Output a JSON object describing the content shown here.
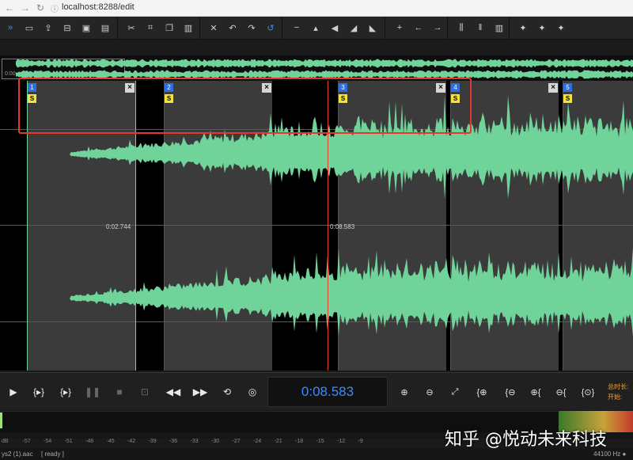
{
  "browser": {
    "back": "←",
    "forward": "→",
    "reload": "↻",
    "info": "ⓘ",
    "url": "localhost:8288/edit"
  },
  "toolbar": {
    "icons": [
      "expand-icon",
      "open-folder-icon",
      "upload-icon",
      "export-icon",
      "save-icon",
      "save-as-icon",
      "cut-icon",
      "crop-icon",
      "copy-icon",
      "paste-icon",
      "delete-icon",
      "undo-icon",
      "redo-icon",
      "reset-icon",
      "minus-icon",
      "plus-small-icon",
      "volume-icon",
      "fade-in-icon",
      "fade-out-icon",
      "add-icon",
      "arrow-left-icon",
      "arrow-right-icon",
      "equalizer-icon",
      "barcode-icon",
      "library-icon",
      "bird-1-icon",
      "bird-2-icon",
      "bird-3-icon"
    ],
    "glyphs": [
      "»",
      "▭",
      "⇪",
      "⊟",
      "▣",
      "▤",
      "✂",
      "⌗",
      "❐",
      "▥",
      "✕",
      "↶",
      "↷",
      "↺",
      "−",
      "▴",
      "◀",
      "◢",
      "◣",
      "+",
      "←",
      "→",
      "⫼",
      "‖",
      "▥",
      "✦",
      "✦",
      "✦"
    ]
  },
  "overview": {
    "time_label": "0:00"
  },
  "regions": [
    {
      "num": "1",
      "s": "S"
    },
    {
      "num": "2",
      "s": "S"
    },
    {
      "num": "3",
      "s": "S"
    },
    {
      "num": "4",
      "s": "S"
    },
    {
      "num": "5",
      "s": "S"
    }
  ],
  "close_glyph": "×",
  "markers": {
    "left": "0:02.744",
    "cursor": "0:08.583"
  },
  "transport": {
    "buttons": [
      "play-icon",
      "play-region-icon",
      "loop-region-icon",
      "pause-icon",
      "stop-icon",
      "record-icon",
      "rewind-icon",
      "fast-forward-icon",
      "repeat-icon",
      "target-icon"
    ],
    "glyphs": [
      "▶",
      "{▸}",
      "{▸}",
      "❚❚",
      "■",
      "⊡",
      "◀◀",
      "▶▶",
      "⟲",
      "◎"
    ],
    "time": "0:08.583",
    "zoom_buttons": [
      "zoom-in-icon",
      "zoom-out-icon",
      "fit-icon",
      "zoom-in-sel-icon",
      "zoom-out-sel-icon",
      "zoom-left-icon",
      "zoom-right-icon",
      "zoom-all-icon"
    ],
    "zoom_glyphs": [
      "⊕",
      "⊖",
      "⤢",
      "{⊕",
      "{⊖",
      "⊕{",
      "⊖{",
      "{⊙}"
    ],
    "total_label": "总时长:",
    "start_label": "开始:"
  },
  "meter_scale": [
    "dB",
    "-57",
    "-54",
    "-51",
    "-48",
    "-45",
    "-42",
    "-39",
    "-36",
    "-33",
    "-30",
    "-27",
    "-24",
    "-21",
    "-18",
    "-15",
    "-12",
    "-9"
  ],
  "watermark": "知乎 @悦动未来科技",
  "status": {
    "file": "ys2 (1).aac",
    "state": "[ ready ]",
    "rate": "44100 Hz ●"
  },
  "colors": {
    "waveform": "#6fd39a",
    "cursor": "#e0412f",
    "time": "#3b8cff",
    "highlight": "#e5372b"
  }
}
